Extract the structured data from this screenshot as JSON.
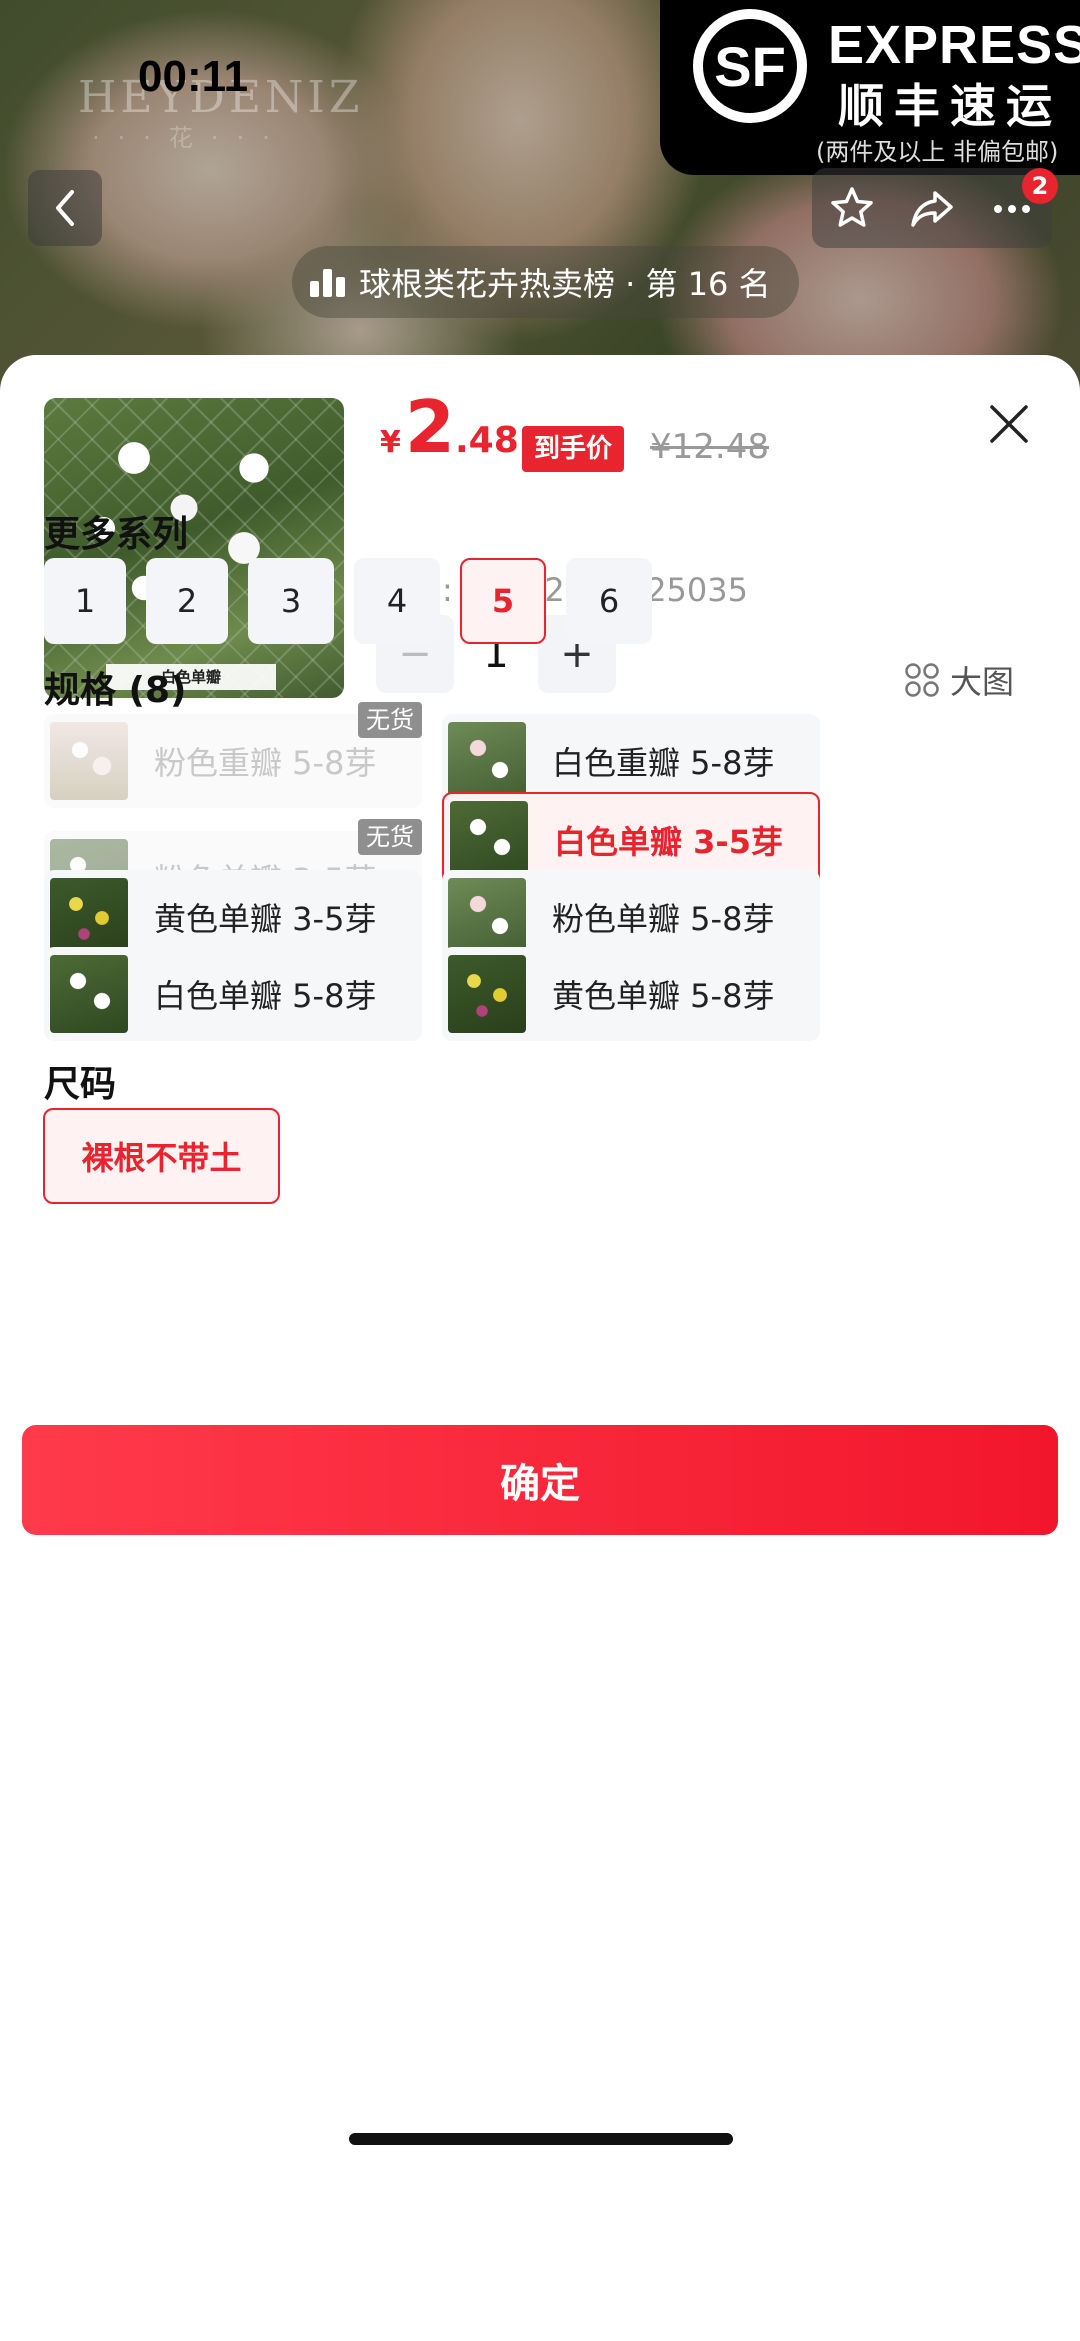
{
  "status_bar": {
    "time": "00:11"
  },
  "hero": {
    "watermark": "HEYDENIZ",
    "watermark_sub": "···花···",
    "rank_text": "球根类花卉热卖榜 · 第 16 名",
    "cart_badge": "2"
  },
  "sf_banner": {
    "express": "EXPRESS",
    "name_cn": "顺丰速运",
    "note": "(两件及以上  非偏包邮)"
  },
  "product": {
    "currency": "¥",
    "price_int": "2",
    "price_dec": ".48",
    "price_tag": "到手价",
    "original_price": "¥12.48",
    "code_label": "编号:  10142392525035",
    "quantity": "1",
    "thumb_caption": "白色单瓣"
  },
  "series": {
    "title": "更多系列",
    "items": [
      "1",
      "2",
      "3",
      "4",
      "5",
      "6"
    ],
    "selected": "5"
  },
  "specs": {
    "title": "规格 (8)",
    "big_view": "大图",
    "out_of_stock": "无货",
    "items": [
      {
        "label": "粉色重瓣 5-8芽",
        "state": "disabled",
        "icon": "pink-flower"
      },
      {
        "label": "白色重瓣 5-8芽",
        "state": "normal",
        "icon": "white-double-flower"
      },
      {
        "label": "粉色单瓣 3-5芽",
        "state": "disabled",
        "icon": "pink-single-flower"
      },
      {
        "label": "白色单瓣 3-5芽",
        "state": "selected",
        "icon": "white-single-flower"
      },
      {
        "label": "黄色单瓣 3-5芽",
        "state": "normal",
        "icon": "yellow-single-flower"
      },
      {
        "label": "粉色单瓣 5-8芽",
        "state": "normal",
        "icon": "pink-single-flower"
      },
      {
        "label": "白色单瓣 5-8芽",
        "state": "normal",
        "icon": "white-single-flower"
      },
      {
        "label": "黄色单瓣 5-8芽",
        "state": "normal",
        "icon": "yellow-single-flower"
      }
    ]
  },
  "size": {
    "title": "尺码",
    "selected": "裸根不带土"
  },
  "confirm_label": "确定",
  "colors": {
    "accent": "#e8242e",
    "chip_bg": "#f4f5f8",
    "selected_bg": "#fff2f3"
  }
}
